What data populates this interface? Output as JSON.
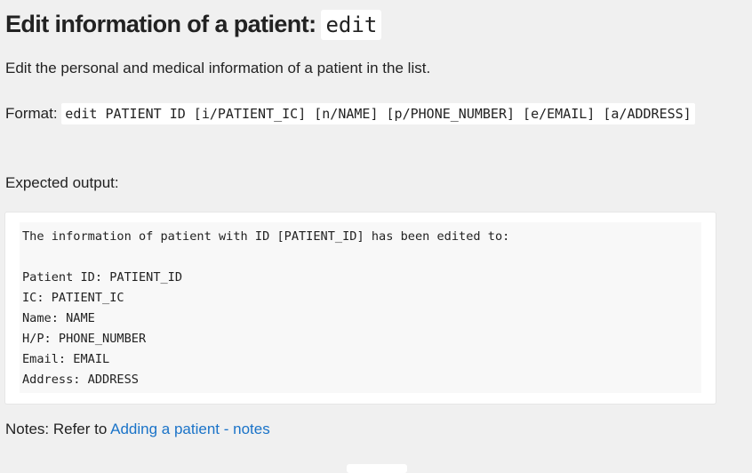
{
  "heading": {
    "text": "Edit information of a patient:",
    "command": "edit"
  },
  "description": "Edit the personal and medical information of a patient in the list.",
  "format": {
    "label": "Format:",
    "code": "edit PATIENT ID [i/PATIENT_IC] [n/NAME] [p/PHONE_NUMBER] [e/EMAIL] [a/ADDRESS]"
  },
  "expected_output_label": "Expected output:",
  "output_lines": [
    "The information of patient with ID [PATIENT_ID] has been edited to:",
    "",
    "Patient ID: PATIENT_ID",
    "IC: PATIENT_IC",
    "Name: NAME",
    "H/P: PHONE_NUMBER",
    "Email: EMAIL",
    "Address: ADDRESS"
  ],
  "notes": {
    "prefix": "Notes: Refer to",
    "link_text": "Adding a patient - notes"
  }
}
